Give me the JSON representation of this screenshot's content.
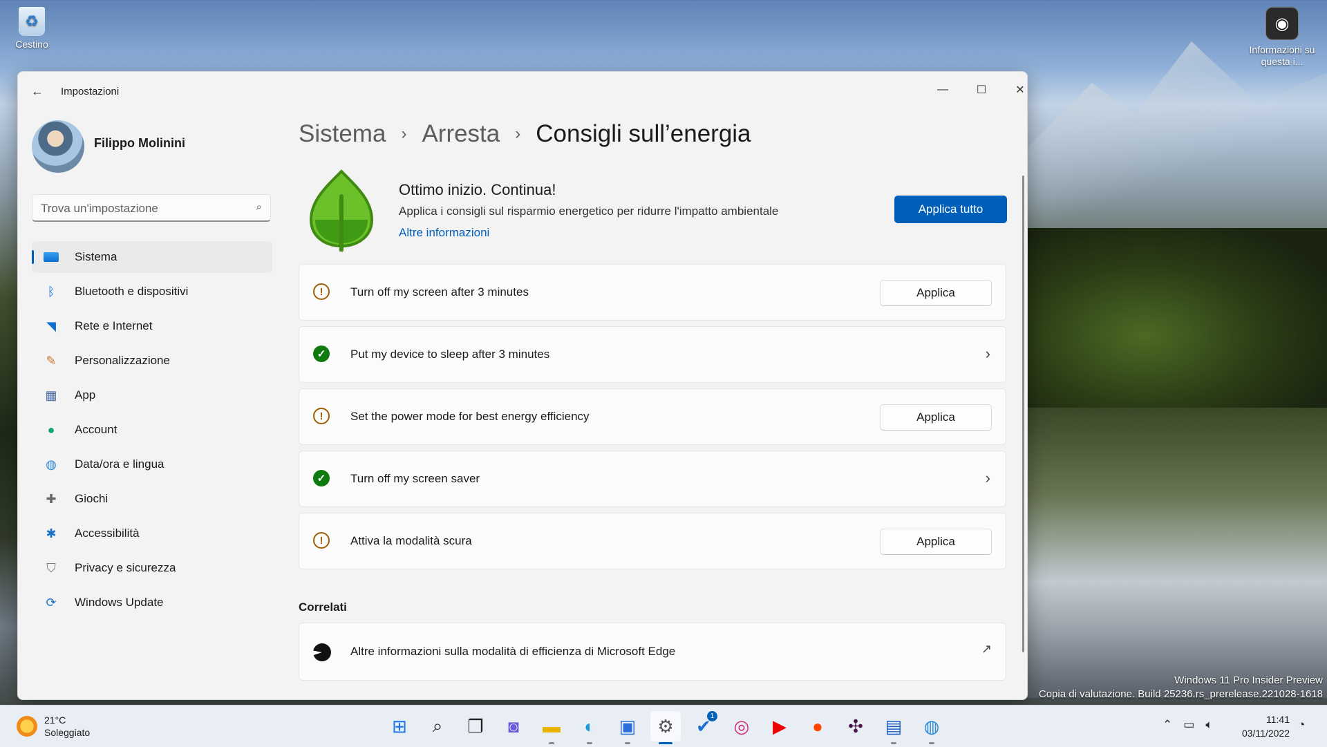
{
  "desktop": {
    "recycle_bin": "Cestino",
    "info_icon": "Informazioni su questa i...",
    "watermark_line1": "Windows 11 Pro Insider Preview",
    "watermark_line2": "Copia di valutazione. Build 25236.rs_prerelease.221028-1618"
  },
  "window": {
    "title": "Impostazioni",
    "back_icon": "back-arrow-icon",
    "controls": [
      "minimize",
      "maximize",
      "close"
    ]
  },
  "profile": {
    "name": "Filippo Molinini"
  },
  "search": {
    "placeholder": "Trova un'impostazione"
  },
  "sidebar": {
    "items": [
      {
        "label": "Sistema",
        "icon": "system-icon",
        "active": true
      },
      {
        "label": "Bluetooth e dispositivi",
        "icon": "bluetooth-icon"
      },
      {
        "label": "Rete e Internet",
        "icon": "wifi-icon"
      },
      {
        "label": "Personalizzazione",
        "icon": "brush-icon"
      },
      {
        "label": "App",
        "icon": "apps-icon"
      },
      {
        "label": "Account",
        "icon": "account-icon"
      },
      {
        "label": "Data/ora e lingua",
        "icon": "globe-icon"
      },
      {
        "label": "Giochi",
        "icon": "gamepad-icon"
      },
      {
        "label": "Accessibilità",
        "icon": "accessibility-icon"
      },
      {
        "label": "Privacy e sicurezza",
        "icon": "shield-icon"
      },
      {
        "label": "Windows Update",
        "icon": "update-icon"
      }
    ]
  },
  "breadcrumb": {
    "level1": "Sistema",
    "level2": "Arresta",
    "current": "Consigli sull’energia"
  },
  "hero": {
    "title": "Ottimo inizio. Continua!",
    "description": "Applica i consigli sul risparmio energetico per ridurre l'impatto ambientale",
    "link": "Altre informazioni",
    "apply_all": "Applica tutto"
  },
  "recommendations": [
    {
      "label": "Turn off my screen after 3 minutes",
      "status": "warning",
      "action": "Applica"
    },
    {
      "label": "Put my device to sleep after 3 minutes",
      "status": "done"
    },
    {
      "label": "Set the power mode for best energy efficiency",
      "status": "warning",
      "action": "Applica"
    },
    {
      "label": "Turn off my screen saver",
      "status": "done"
    },
    {
      "label": "Attiva la modalità scura",
      "status": "warning",
      "action": "Applica"
    }
  ],
  "related": {
    "title": "Correlati",
    "item": "Altre informazioni sulla modalità di efficienza di Microsoft Edge"
  },
  "taskbar": {
    "weather_temp": "21°C",
    "weather_desc": "Soleggiato",
    "time": "11:41",
    "date": "03/11/2022",
    "apps": [
      "start-icon",
      "search-icon",
      "task-view-icon",
      "chat-icon",
      "file-explorer-icon",
      "edge-icon",
      "store-icon",
      "settings-icon",
      "todo-icon",
      "instagram-icon",
      "youtube-icon",
      "reddit-icon",
      "slack-icon",
      "news-icon",
      "globe-app-icon"
    ],
    "todo_badge": "1"
  },
  "colors": {
    "accent": "#005fb8",
    "warning": "#9d5d00",
    "success": "#0f7b0f",
    "leaf": "#6cc12a"
  }
}
